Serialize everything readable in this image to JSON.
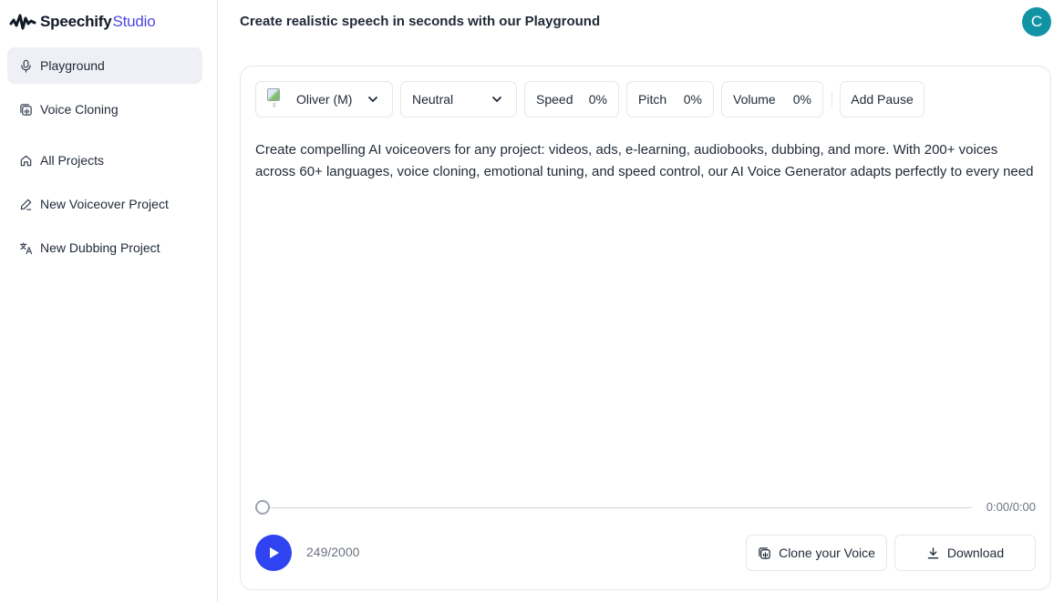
{
  "app": {
    "brand": "Speechify",
    "brand_suffix": "Studio"
  },
  "sidebar": {
    "items": [
      {
        "label": "Playground",
        "icon": "microphone-icon",
        "active": true
      },
      {
        "label": "Voice Cloning",
        "icon": "voice-clone-icon",
        "active": false
      },
      {
        "label": "All Projects",
        "icon": "home-icon",
        "active": false
      },
      {
        "label": "New Voiceover Project",
        "icon": "pen-icon",
        "active": false
      },
      {
        "label": "New Dubbing Project",
        "icon": "translate-icon",
        "active": false
      }
    ]
  },
  "header": {
    "title": "Create realistic speech in seconds with our Playground",
    "avatar_initial": "C",
    "avatar_color": "#1293a4"
  },
  "toolbar": {
    "voice": "Oliver (M)",
    "voice_image_alt": "Il",
    "emotion": "Neutral",
    "speed_label": "Speed",
    "speed_value": "0%",
    "pitch_label": "Pitch",
    "pitch_value": "0%",
    "volume_label": "Volume",
    "volume_value": "0%",
    "add_pause_label": "Add Pause"
  },
  "editor": {
    "text": "Create compelling AI voiceovers for any project: videos, ads, e-learning, audiobooks, dubbing, and more. With 200+ voices across 60+ languages, voice cloning, emotional tuning, and speed control, our AI Voice Generator adapts perfectly to every need"
  },
  "player": {
    "time": "0:00/0:00",
    "progress": 0,
    "char_count": "249/2000",
    "play_color": "#2f44f0"
  },
  "actions": {
    "clone_label": "Clone your Voice",
    "download_label": "Download"
  }
}
